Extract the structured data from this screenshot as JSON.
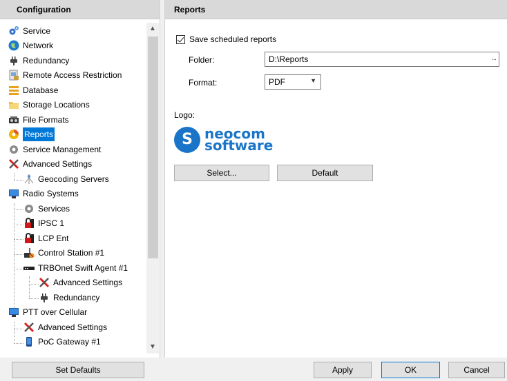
{
  "left": {
    "header": "Configuration",
    "tree": [
      {
        "label": "Service",
        "icon": "service-gear-icon"
      },
      {
        "label": "Network",
        "icon": "globe-icon"
      },
      {
        "label": "Redundancy",
        "icon": "plug-icon"
      },
      {
        "label": "Remote Access Restriction",
        "icon": "lock-computer-icon"
      },
      {
        "label": "Database",
        "icon": "database-icon"
      },
      {
        "label": "Storage Locations",
        "icon": "folder-icon"
      },
      {
        "label": "File Formats",
        "icon": "tape-recorder-icon"
      },
      {
        "label": "Reports",
        "icon": "reports-icon",
        "selected": true
      },
      {
        "label": "Service Management",
        "icon": "gear-icon"
      },
      {
        "label": "Advanced Settings",
        "icon": "tools-icon"
      },
      {
        "label": "Geocoding Servers",
        "icon": "geocoding-icon"
      },
      {
        "label": "Radio Systems",
        "icon": "computer-icon"
      },
      {
        "label": "Services",
        "icon": "gear-icon"
      },
      {
        "label": "IPSC 1",
        "icon": "ipsc-lock-icon"
      },
      {
        "label": "LCP Ent",
        "icon": "lcp-lock-icon"
      },
      {
        "label": "Control Station #1",
        "icon": "radio-station-icon"
      },
      {
        "label": "TRBOnet Swift Agent #1",
        "icon": "swift-agent-icon"
      },
      {
        "label": "Advanced Settings",
        "icon": "tools-icon"
      },
      {
        "label": "Redundancy",
        "icon": "plug-icon"
      },
      {
        "label": "PTT over Cellular",
        "icon": "computer-icon"
      },
      {
        "label": "Advanced Settings",
        "icon": "tools-icon"
      },
      {
        "label": "PoC Gateway #1",
        "icon": "phone-icon"
      }
    ],
    "set_defaults": "Set Defaults"
  },
  "right": {
    "header": "Reports",
    "save_label": "Save scheduled reports",
    "save_checked": true,
    "folder_label": "Folder:",
    "folder_value": "D:\\Reports",
    "folder_browse": "...",
    "format_label": "Format:",
    "format_value": "PDF",
    "logo_label": "Logo:",
    "logo_text_1": "neocom",
    "logo_text_2": "software",
    "select_btn": "Select...",
    "default_btn": "Default"
  },
  "footer": {
    "apply": "Apply",
    "ok": "OK",
    "cancel": "Cancel"
  },
  "colors": {
    "selection": "#0078d7",
    "logo": "#1a75c8",
    "header_bg": "#d9d9d9"
  }
}
